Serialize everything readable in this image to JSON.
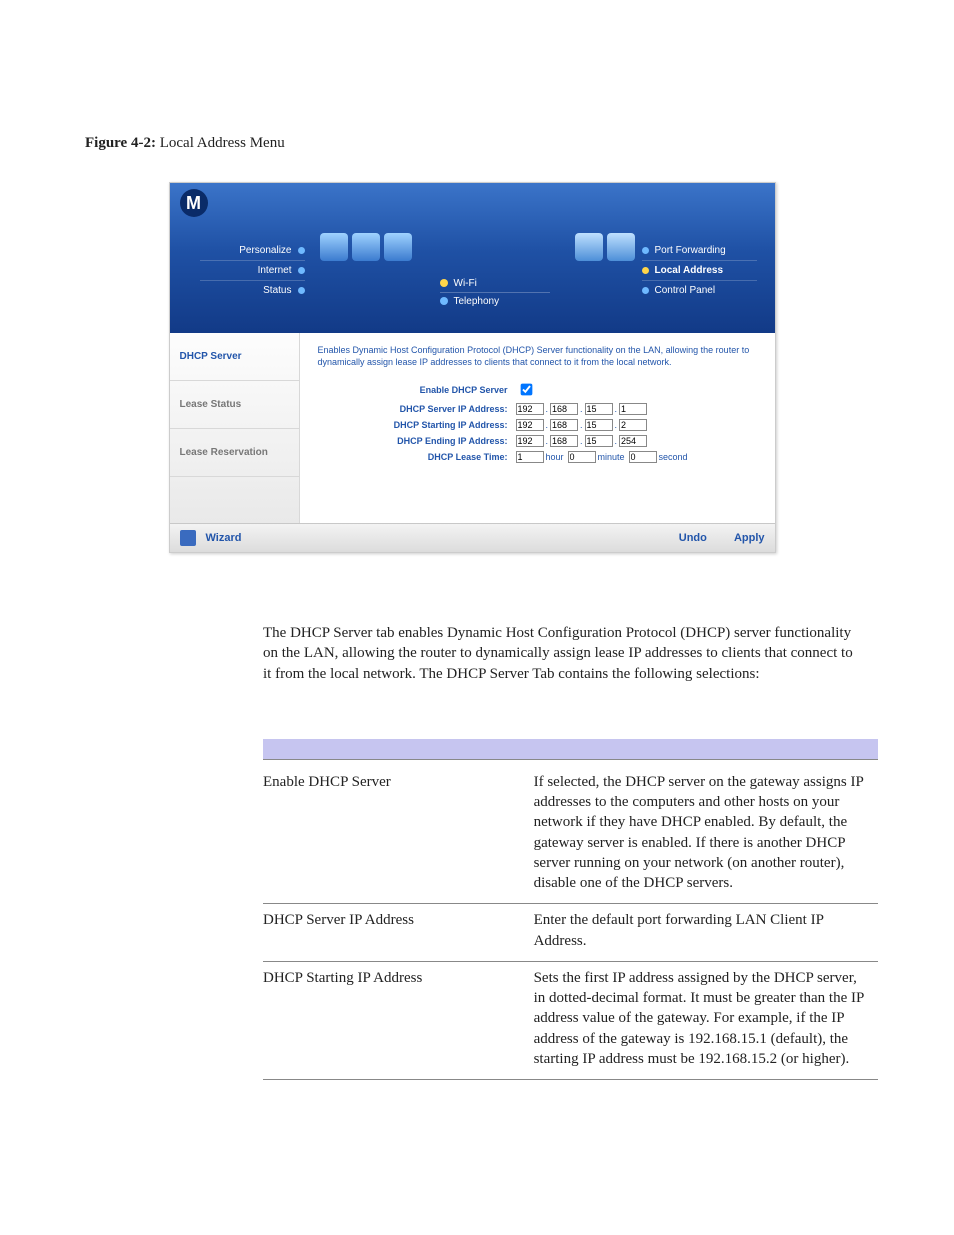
{
  "figure": {
    "label": "Figure 4-2:",
    "title": "Local Address Menu"
  },
  "router": {
    "nav_left": {
      "personalize": "Personalize",
      "internet": "Internet",
      "status": "Status"
    },
    "center_tabs": {
      "wifi": "Wi-Fi",
      "telephony": "Telephony"
    },
    "nav_right": {
      "port_fwd": "Port Forwarding",
      "local_addr": "Local Address",
      "ctrl_panel": "Control Panel"
    },
    "side": {
      "dhcp_server": "DHCP Server",
      "lease_status": "Lease Status",
      "lease_res": "Lease Reservation"
    },
    "main": {
      "description": "Enables Dynamic Host Configuration Protocol (DHCP) Server functionality on the LAN, allowing the router to dynamically assign lease IP addresses to clients that connect to it from the local network.",
      "labels": {
        "enable": "Enable DHCP Server",
        "server_ip": "DHCP Server IP Address:",
        "start_ip": "DHCP Starting IP Address:",
        "end_ip": "DHCP Ending IP Address:",
        "lease_time": "DHCP Lease Time:"
      },
      "ip": {
        "server": [
          "192",
          "168",
          "15",
          "1"
        ],
        "start": [
          "192",
          "168",
          "15",
          "2"
        ],
        "end": [
          "192",
          "168",
          "15",
          "254"
        ]
      },
      "lease": {
        "hour": "1",
        "minute": "0",
        "second": "0",
        "hour_u": "hour",
        "minute_u": "minute",
        "second_u": "second"
      }
    },
    "footer": {
      "wizard": "Wizard",
      "undo": "Undo",
      "apply": "Apply"
    }
  },
  "paragraph": "The DHCP Server tab enables Dynamic Host Configuration Protocol (DHCP) server functionality on the LAN, allowing the router to dynamically assign lease IP addresses to clients that connect to it from the local network. The DHCP Server Tab contains the following selections:",
  "table": {
    "rows": [
      {
        "k": "Enable DHCP Server",
        "v": "If selected, the DHCP server on the gateway assigns IP addresses to the computers and other hosts on your network if they have DHCP enabled. By default, the gateway server is enabled. If there is another DHCP server running on your network (on another router), disable one of the DHCP servers."
      },
      {
        "k": "DHCP Server IP Address",
        "v": "Enter the default port forwarding LAN Client IP Address."
      },
      {
        "k": "DHCP Starting IP Address",
        "v": "Sets the first IP address assigned by the DHCP server, in dotted-decimal format. It must be greater than the IP address value of the gateway. For example, if the IP address of the gateway is 192.168.15.1 (default), the starting IP address must be 192.168.15.2 (or higher)."
      }
    ]
  }
}
